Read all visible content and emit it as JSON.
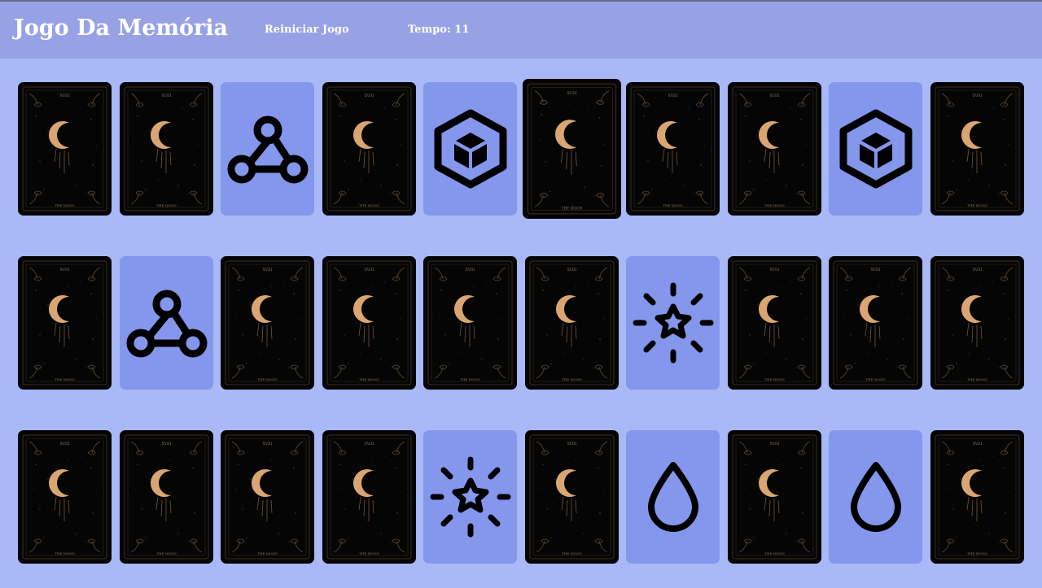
{
  "header": {
    "title": "Jogo Da Memória",
    "restart_label": "Reiniciar Jogo",
    "timer_label": "Tempo: 11"
  },
  "colors": {
    "background": "#a9b8f6",
    "header": "#97a2e5",
    "card_back": "#050505",
    "card_face": "#8497ec",
    "moon_gold": "#d9a673",
    "icon": "#000000"
  },
  "board": {
    "rows": 3,
    "cols": 10,
    "card_back_caption": "THE MOON",
    "card_back_numeral": "XVIII",
    "cards": [
      [
        "back",
        "triangle-nodes-icon",
        "back",
        "cube-icon",
        "back",
        "back",
        "back",
        "cube-icon",
        "back"
      ],
      []
    ]
  },
  "grid": [
    [
      "back",
      "back",
      "webhook-icon",
      "back",
      "cube-icon",
      "back",
      "back",
      "back",
      "cube-icon",
      "back"
    ],
    [
      "back",
      "webhook-icon",
      "back",
      "back",
      "back",
      "back",
      "star-burst-icon",
      "back",
      "back",
      "back"
    ],
    [
      "back",
      "back",
      "back",
      "back",
      "star-burst-icon",
      "back",
      "drop-icon",
      "back",
      "drop-icon",
      "back"
    ]
  ]
}
